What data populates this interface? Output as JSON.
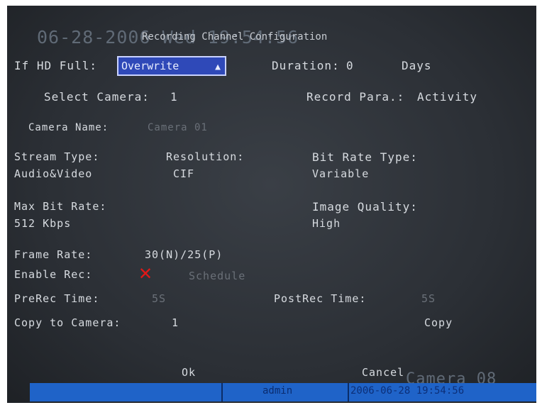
{
  "osd": {
    "date_overlay": "06-28-2006 Wed 19:54:56",
    "camera_overlay": "Camera 08"
  },
  "dialog": {
    "title": "Recording Channel Configuration",
    "if_hd_full_label": "If HD Full:",
    "if_hd_full_value": "Overwrite",
    "duration_label": "Duration:",
    "duration_value": "0",
    "duration_unit": "Days",
    "select_camera_label": "Select Camera:",
    "select_camera_value": "1",
    "record_para_label": "Record Para.:",
    "record_para_value": "Activity",
    "camera_name_label": "Camera Name:",
    "camera_name_value": "Camera 01",
    "stream_type_label": "Stream Type:",
    "stream_type_value": "Audio&Video",
    "resolution_label": "Resolution:",
    "resolution_value": "CIF",
    "bit_rate_type_label": "Bit Rate Type:",
    "bit_rate_type_value": "Variable",
    "max_bit_rate_label": "Max Bit Rate:",
    "max_bit_rate_value": "512 Kbps",
    "image_quality_label": "Image Quality:",
    "image_quality_value": "High",
    "frame_rate_label": "Frame Rate:",
    "frame_rate_value": "30(N)/25(P)",
    "enable_rec_label": "Enable Rec:",
    "schedule_label": "Schedule",
    "prerec_label": "PreRec Time:",
    "prerec_value": "5S",
    "postrec_label": "PostRec Time:",
    "postrec_value": "5S",
    "copy_to_camera_label": "Copy to Camera:",
    "copy_to_camera_value": "1",
    "copy_button": "Copy",
    "ok_button": "Ok",
    "cancel_button": "Cancel"
  },
  "status_bar": {
    "user": "admin",
    "datetime": "2006-06-28 19:54:56"
  },
  "colors": {
    "background": "#2b2f35",
    "text": "#d7dbe0",
    "dim_text": "#6a7078",
    "selected": "#2f49b8",
    "status_bar": "#1f63c8",
    "enable_mark": "#e01818"
  }
}
